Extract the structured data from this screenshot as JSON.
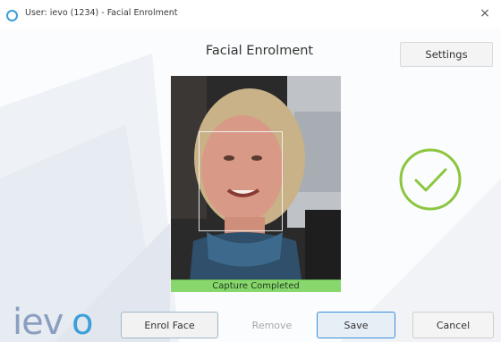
{
  "window": {
    "title": "User: ievo (1234) - Facial Enrolment",
    "close_label": "×"
  },
  "header": {
    "title": "Facial Enrolment",
    "settings_label": "Settings"
  },
  "camera": {
    "status_text": "Capture Completed",
    "status_color": "#88d76d"
  },
  "status_icon": {
    "name": "check-circle-icon",
    "color": "#8cc63f"
  },
  "branding": {
    "logo_text": "ievo",
    "logo_color": "#8a9fbf"
  },
  "buttons": {
    "enrol_face": "Enrol Face",
    "remove": "Remove",
    "save": "Save",
    "cancel": "Cancel"
  },
  "colors": {
    "accent": "#3b8ed8",
    "success": "#8cc63f"
  }
}
